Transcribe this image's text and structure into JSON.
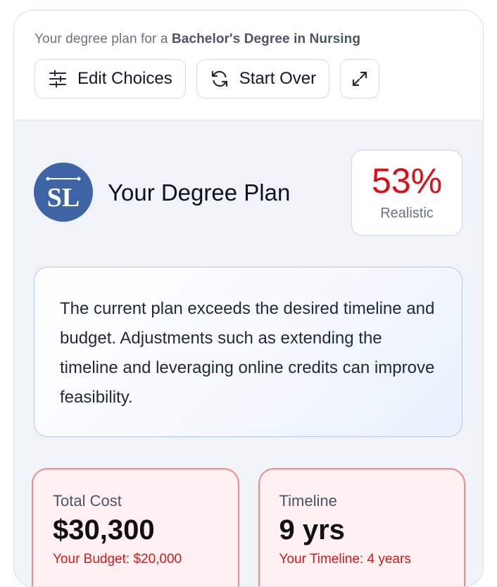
{
  "header": {
    "subtitle_prefix": "Your degree plan for a",
    "degree_name": "Bachelor's Degree in Nursing",
    "edit_label": "Edit Choices",
    "start_over_label": "Start Over",
    "icons": {
      "edit": "sliders-icon",
      "start_over": "refresh-icon",
      "expand": "expand-icon"
    }
  },
  "plan": {
    "logo_text": "SL",
    "title": "Your Degree Plan",
    "score": "53%",
    "score_label": "Realistic",
    "score_color": "#e00d17"
  },
  "summary": "The current plan exceeds the desired timeline and budget. Adjustments such as extending the timeline and leveraging online credits can improve feasibility.",
  "metrics": [
    {
      "label": "Total Cost",
      "value": "$30,300",
      "note": "Your Budget: $20,000"
    },
    {
      "label": "Timeline",
      "value": "9 yrs",
      "note": "Your Timeline: 4 years"
    }
  ],
  "colors": {
    "brand": "#3f64a5",
    "alert": "#e00d17",
    "alert_bg": "#fff1f1"
  }
}
